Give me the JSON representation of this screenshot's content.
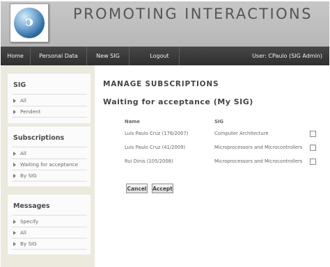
{
  "header": {
    "title": "PROMOTING INTERACTIONS",
    "logo_icon": "sig-logo-icon"
  },
  "nav": {
    "items": [
      {
        "label": "Home"
      },
      {
        "label": "Personal Data"
      },
      {
        "label": "New SIG"
      },
      {
        "label": "Logout"
      }
    ],
    "user": "User: CPaulo (SIG Admin)"
  },
  "sidebar": {
    "sig": {
      "title": "SIG",
      "items": [
        "All",
        "Pendent"
      ]
    },
    "subscriptions": {
      "title": "Subscriptions",
      "items": [
        "All",
        "Waiting for acceptance",
        "By SIG"
      ]
    },
    "messages": {
      "title": "Messages",
      "items": [
        "Specify",
        "All",
        "By SIG"
      ]
    }
  },
  "main": {
    "title": "MANAGE SUBSCRIPTIONS",
    "subtitle": "Waiting for acceptance (My SIG)",
    "columns": {
      "name": "Name",
      "sig": "SIG"
    },
    "rows": [
      {
        "name": "Luis Paulo Cruz (176/2007)",
        "sig": "Computer Architecture",
        "checked": false
      },
      {
        "name": "Luis Paulo Cruz (41/2009)",
        "sig": "Microprocessors and Microcontrollers",
        "checked": false
      },
      {
        "name": "Rui Dinis (105/2008)",
        "sig": "Microprocessors and Microcontrollers",
        "checked": false
      }
    ],
    "cancel_label": "Cancel",
    "accept_label": "Accept"
  }
}
